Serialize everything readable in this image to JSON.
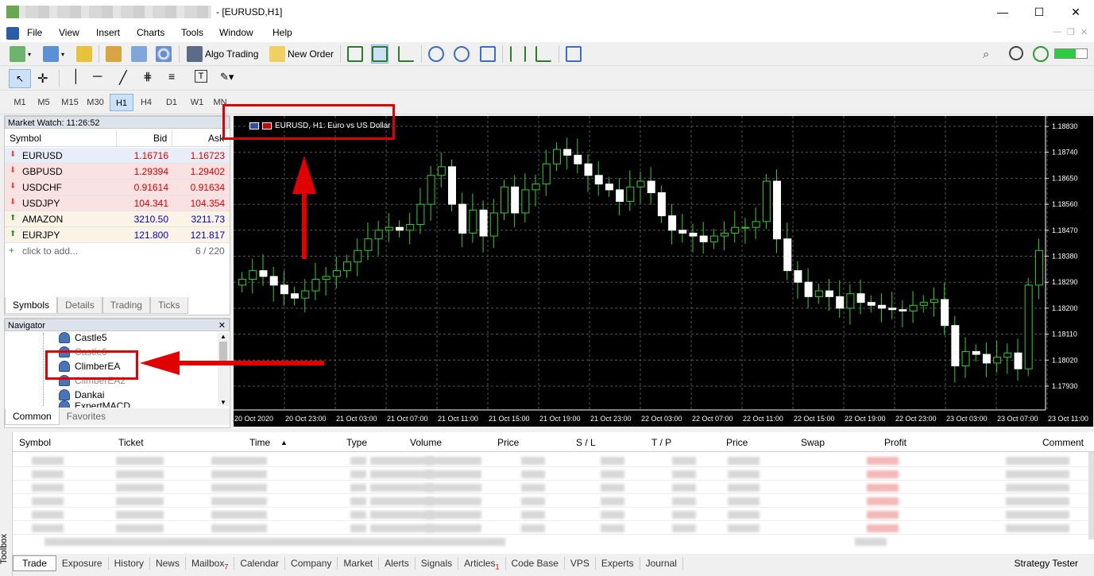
{
  "window": {
    "title": "- [EURUSD,H1]",
    "controls": {
      "minimize": "—",
      "maximize": "☐",
      "close": "✕"
    }
  },
  "menu": [
    "File",
    "View",
    "Insert",
    "Charts",
    "Tools",
    "Window",
    "Help"
  ],
  "toolbar": {
    "algo_trading": "Algo Trading",
    "new_order": "New Order"
  },
  "timeframes": [
    "M1",
    "M5",
    "M15",
    "M30",
    "H1",
    "H4",
    "D1",
    "W1",
    "MN"
  ],
  "timeframe_active": "H1",
  "market_watch": {
    "title": "Market Watch: 11:26:52",
    "headers": {
      "symbol": "Symbol",
      "bid": "Bid",
      "ask": "Ask"
    },
    "rows": [
      {
        "symbol": "EURUSD",
        "bid": "1.16716",
        "ask": "1.16723",
        "dir": "down",
        "bg": "#e8eef8"
      },
      {
        "symbol": "GBPUSD",
        "bid": "1.29394",
        "ask": "1.29402",
        "dir": "down",
        "bg": "#fbe2e2"
      },
      {
        "symbol": "USDCHF",
        "bid": "0.91614",
        "ask": "0.91634",
        "dir": "down",
        "bg": "#fbe2e2"
      },
      {
        "symbol": "USDJPY",
        "bid": "104.341",
        "ask": "104.354",
        "dir": "down",
        "bg": "#fbe2e2"
      },
      {
        "symbol": "AMAZON",
        "bid": "3210.50",
        "ask": "3211.73",
        "dir": "up",
        "bg": "#fbf3e5"
      },
      {
        "symbol": "EURJPY",
        "bid": "121.800",
        "ask": "121.817",
        "dir": "up",
        "bg": "#fbf3e5"
      }
    ],
    "add_label": "click to add...",
    "count": "6 / 220",
    "tabs": [
      "Symbols",
      "Details",
      "Trading",
      "Ticks"
    ]
  },
  "navigator": {
    "title": "Navigator",
    "items": [
      "Castle5",
      "Castle6",
      "ClimberEA",
      "ClimberEA2",
      "Dankai",
      "ExpertMACD"
    ],
    "tabs": [
      "Common",
      "Favorites"
    ]
  },
  "chart": {
    "label": "EURUSD, H1: Euro vs US Dollar",
    "price_ticks": [
      "1.18830",
      "1.18740",
      "1.18650",
      "1.18560",
      "1.18470",
      "1.18380",
      "1.18290",
      "1.18200",
      "1.18110",
      "1.18020",
      "1.17930"
    ],
    "time_ticks": [
      "20 Oct 2020",
      "20 Oct 23:00",
      "21 Oct 03:00",
      "21 Oct 07:00",
      "21 Oct 11:00",
      "21 Oct 15:00",
      "21 Oct 19:00",
      "21 Oct 23:00",
      "22 Oct 03:00",
      "22 Oct 07:00",
      "22 Oct 11:00",
      "22 Oct 15:00",
      "22 Oct 19:00",
      "22 Oct 23:00",
      "23 Oct 03:00",
      "23 Oct 07:00",
      "23 Oct 11:00"
    ],
    "up_color": "#33cc33",
    "down_color": "#ffffff",
    "bg": "#000000"
  },
  "terminal": {
    "headers": [
      "Symbol",
      "Ticket",
      "Time",
      "Type",
      "Volume",
      "Price",
      "S / L",
      "T / P",
      "Price",
      "Swap",
      "Profit",
      "Comment"
    ],
    "tabs": [
      {
        "label": "Trade"
      },
      {
        "label": "Exposure"
      },
      {
        "label": "History"
      },
      {
        "label": "News"
      },
      {
        "label": "Mailbox",
        "badge": "7"
      },
      {
        "label": "Calendar"
      },
      {
        "label": "Company"
      },
      {
        "label": "Market"
      },
      {
        "label": "Alerts"
      },
      {
        "label": "Signals"
      },
      {
        "label": "Articles",
        "badge": "1"
      },
      {
        "label": "Code Base"
      },
      {
        "label": "VPS"
      },
      {
        "label": "Experts"
      },
      {
        "label": "Journal"
      }
    ],
    "strategy_tester": "Strategy Tester",
    "toolbox": "Toolbox"
  }
}
